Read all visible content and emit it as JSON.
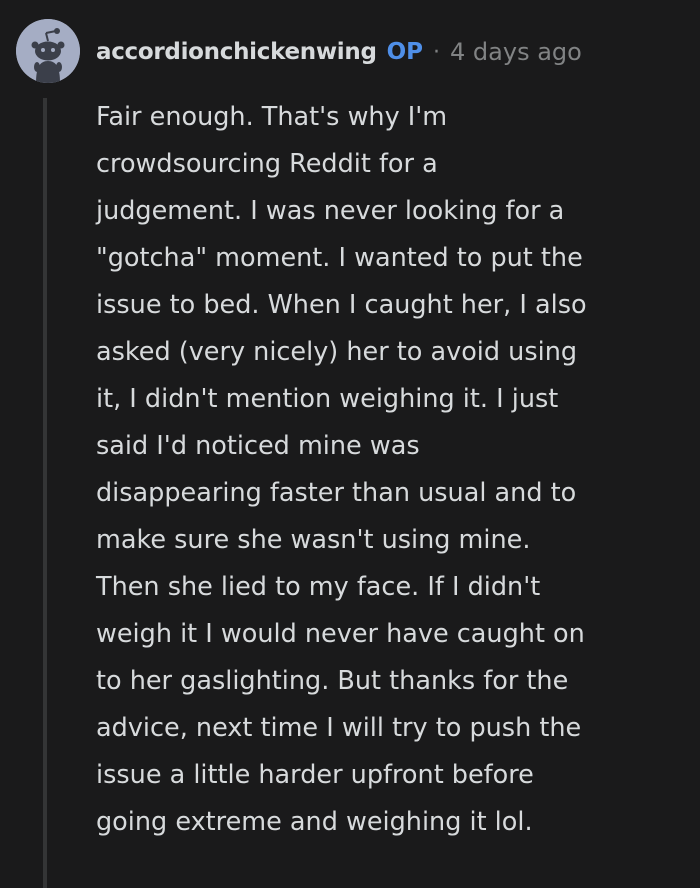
{
  "comment": {
    "username": "accordionchickenwing",
    "badge": "OP",
    "separator": "·",
    "timestamp": "4 days ago",
    "body_lines": [
      "Fair enough. That's why I'm",
      "crowdsourcing Reddit for a",
      "judgement. I was never looking for a",
      "\"gotcha\" moment. I wanted to put the",
      "issue to bed. When I caught her, I also",
      "asked (very nicely) her to avoid using",
      "it, I didn't mention weighing it. I just",
      "said I'd noticed mine was",
      "disappearing faster than usual and to",
      "make sure she wasn't using mine.",
      "Then she lied to my face. If I didn't",
      "weigh it I would never have caught on",
      "to her gaslighting. But thanks for the",
      "advice, next time I will try to push the",
      "issue a little harder upfront before",
      "going extreme and weighing it lol."
    ]
  },
  "colors": {
    "background": "#1a1a1b",
    "text": "#d7dadc",
    "meta": "#818384",
    "op_badge": "#4f8fe8",
    "avatar_bg": "#a5adc4",
    "thread_line": "#343536"
  },
  "icons": {
    "avatar": "snoo-avatar-icon"
  }
}
